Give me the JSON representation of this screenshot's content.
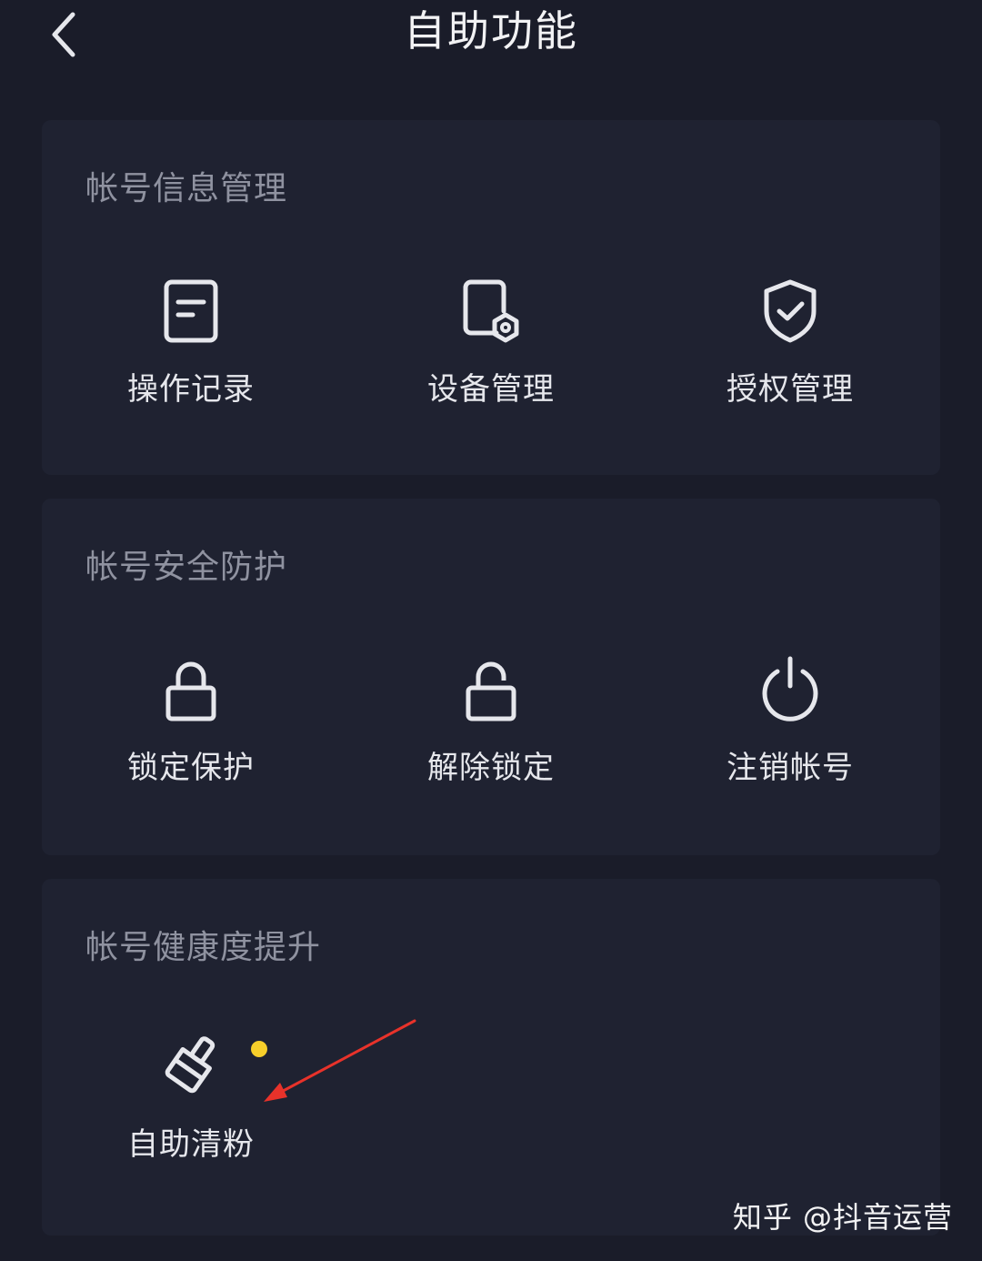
{
  "header": {
    "title": "自助功能",
    "back_icon": "chevron-left-icon"
  },
  "sections": [
    {
      "title": "帐号信息管理",
      "items": [
        {
          "label": "操作记录",
          "icon": "document-icon"
        },
        {
          "label": "设备管理",
          "icon": "device-settings-icon"
        },
        {
          "label": "授权管理",
          "icon": "shield-check-icon"
        }
      ]
    },
    {
      "title": "帐号安全防护",
      "items": [
        {
          "label": "锁定保护",
          "icon": "lock-icon"
        },
        {
          "label": "解除锁定",
          "icon": "unlock-icon"
        },
        {
          "label": "注销帐号",
          "icon": "power-icon"
        }
      ]
    },
    {
      "title": "帐号健康度提升",
      "items": [
        {
          "label": "自助清粉",
          "icon": "brush-icon",
          "badge_color": "#f7cf2a"
        }
      ]
    }
  ],
  "watermark": "知乎 @抖音运营",
  "colors": {
    "background": "#1a1c29",
    "card": "#1f2231",
    "section_title": "#8f92a0",
    "label": "#e6e7ec",
    "badge": "#f7cf2a",
    "annotation_arrow": "#e8322a"
  }
}
